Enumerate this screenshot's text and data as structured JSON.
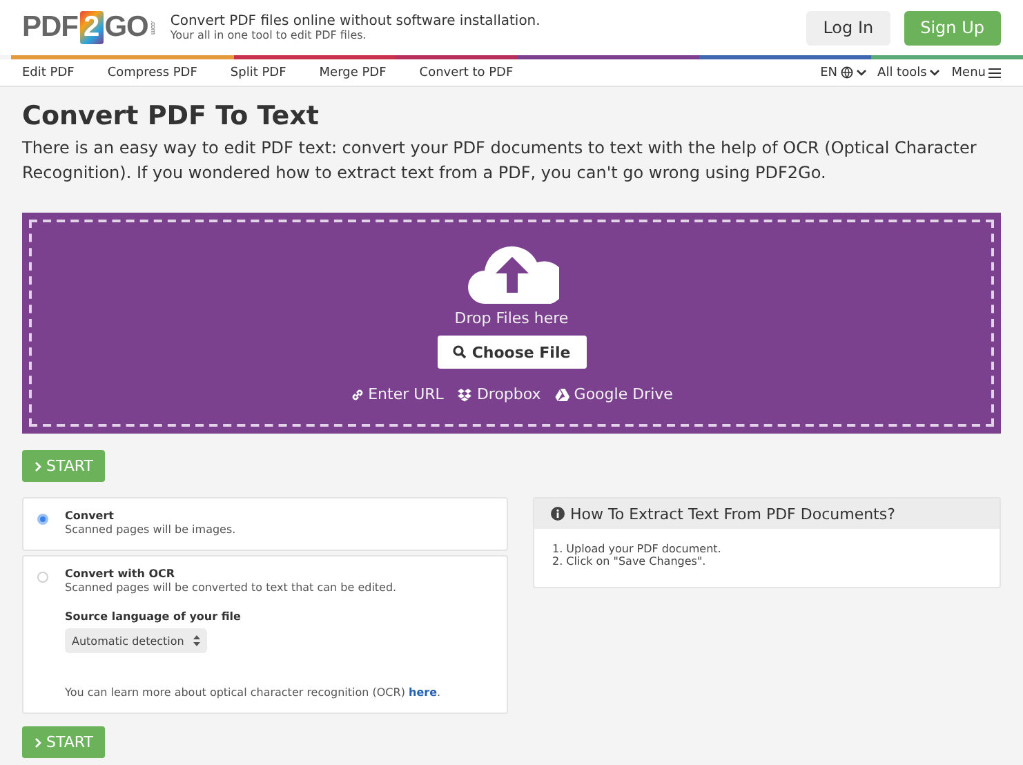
{
  "logo": {
    "left": "PDF",
    "badge": "2",
    "right": "GO",
    "suffix": ".com"
  },
  "tagline": {
    "title": "Convert PDF files online without software installation.",
    "subtitle": "Your all in one tool to edit PDF files."
  },
  "account_buttons": [
    {
      "label": "Log In",
      "kind": "plain"
    },
    {
      "label": "Sign Up",
      "kind": "primary"
    }
  ],
  "nav": {
    "items": [
      "Edit PDF",
      "Compress PDF",
      "Split PDF",
      "Merge PDF",
      "Convert to PDF"
    ],
    "language": "EN",
    "all_tools": "All tools",
    "menu": "Menu"
  },
  "page": {
    "title": "Convert PDF To Text",
    "description": "There is an easy way to edit PDF text: convert your PDF documents to text with the help of OCR (Optical Character Recognition). If you wondered how to extract text from a PDF, you can't go wrong using PDF2Go."
  },
  "dropzone": {
    "hint": "Drop Files here",
    "choose": "Choose File",
    "sources": [
      {
        "kind": "url",
        "label": "Enter URL"
      },
      {
        "kind": "dropbox",
        "label": "Dropbox"
      },
      {
        "kind": "drive",
        "label": "Google Drive"
      }
    ]
  },
  "start_buttons": [
    "START",
    "START"
  ],
  "options": [
    {
      "title": "Convert",
      "description": "Scanned pages will be images.",
      "selected": true
    },
    {
      "title": "Convert with OCR",
      "description": "Scanned pages will be converted to text that can be edited.",
      "selected": false,
      "language_label": "Source language of your file",
      "language_value": "Automatic detection",
      "note": "You can learn more about optical character recognition (OCR)",
      "note_link": "here",
      "note_end": "."
    }
  ],
  "help": {
    "title": "How To Extract Text From PDF Documents?",
    "steps": [
      "1. Upload your PDF document.",
      "2. Click on \"Save Changes\"."
    ]
  }
}
